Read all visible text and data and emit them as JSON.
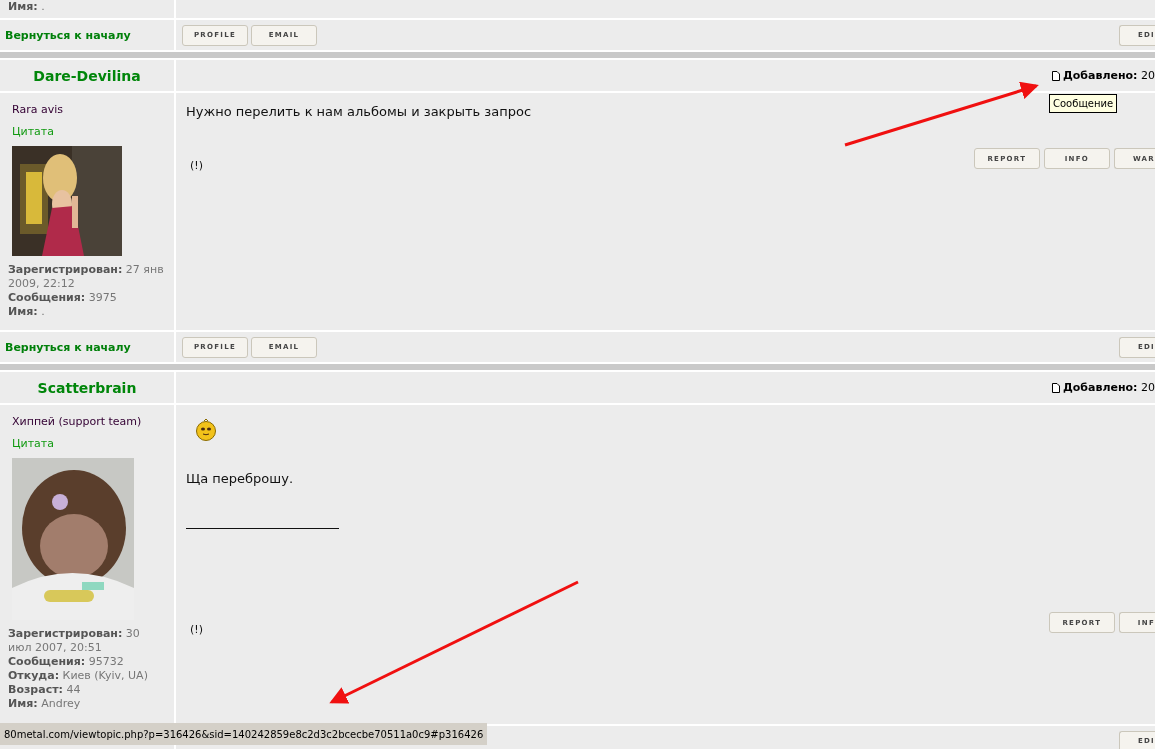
{
  "previous_post": {
    "profile_fields": [
      "**Имя:** ."
    ],
    "back_link": "Вернуться к началу",
    "footer_buttons": [
      "PROFILE",
      "EMAIL"
    ],
    "edit_button": "EDI"
  },
  "posts": [
    {
      "author": "Dare-Devilina",
      "posted_label": "Добавлено:",
      "posted_value": "20",
      "rank": "Rara avis",
      "quote_link": "Цитата",
      "avatar": {
        "kind": "picture"
      },
      "profile_fields": [
        "**Зарегистрирован:** 27 янв 2009, 22:12",
        "**Сообщения:** 3975",
        "**Имя:** ."
      ],
      "body": [
        {
          "kind": "text",
          "text": "Нужно перелить к нам альбомы и закрыть запрос"
        }
      ],
      "report_mark": "(!)",
      "action_buttons": [
        "REPORT",
        "INFO",
        "WAR"
      ],
      "back_link": "Вернуться к началу",
      "footer_buttons": [
        "PROFILE",
        "EMAIL"
      ],
      "edit_button": "EDI"
    },
    {
      "author": "Scatterbrain",
      "posted_label": "Добавлено:",
      "posted_value": "20",
      "rank": "Хиппей (support team)",
      "quote_link": "Цитата",
      "avatar": {
        "kind": "picture"
      },
      "profile_fields": [
        "**Зарегистрирован:** 30 июл 2007, 20:51",
        "**Сообщения:** 95732",
        "**Откуда:** Киев (Kyiv, UA)",
        "**Возраст:** 44",
        "**Имя:** Andrey"
      ],
      "body": [
        {
          "kind": "smiley"
        },
        {
          "kind": "text",
          "text": "Ща переброшу."
        },
        {
          "kind": "rule"
        }
      ],
      "report_mark": "(!)",
      "action_buttons": [
        "REPORT",
        "INF"
      ],
      "edit_button": "EDI"
    }
  ],
  "tooltip": "Сообщение",
  "status_bar": "80metal.com/viewtopic.php?p=316426&sid=140242859e8c2d3c2bcecbe70511a0c9#p316426"
}
